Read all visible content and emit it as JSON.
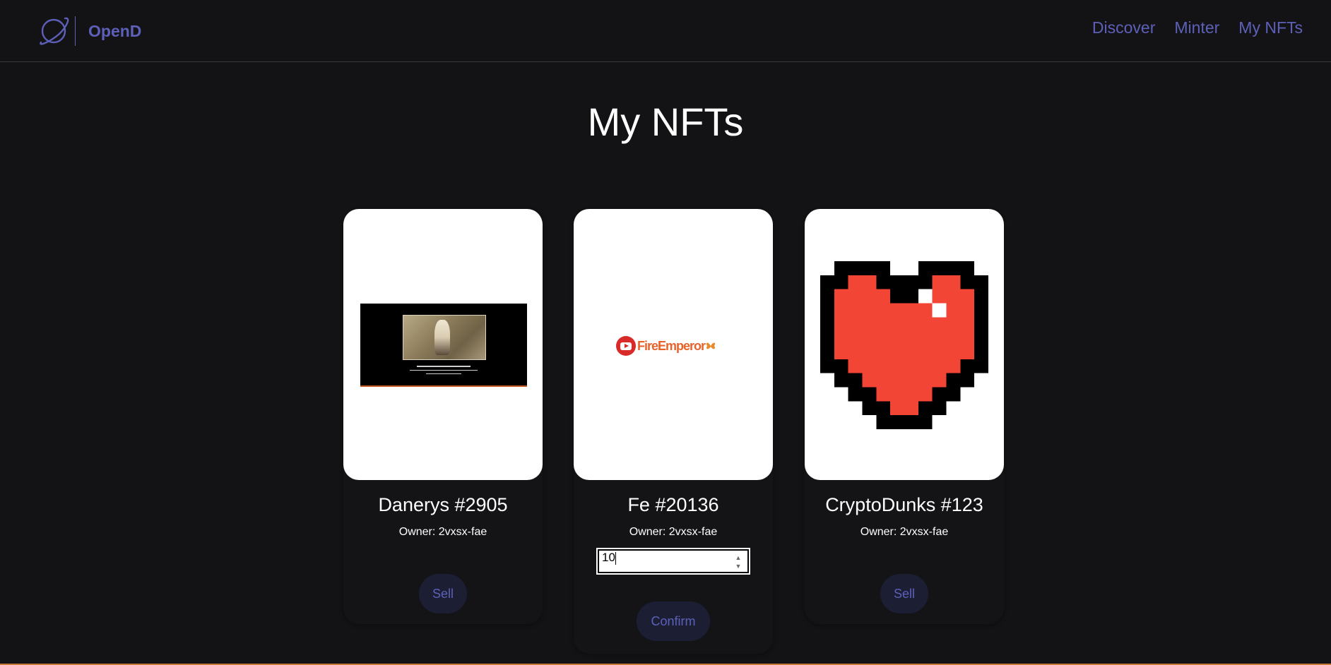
{
  "brand": {
    "name": "OpenD",
    "logo_icon": "planet-icon"
  },
  "nav": {
    "discover": "Discover",
    "minter": "Minter",
    "my_nfts": "My NFTs"
  },
  "page": {
    "title": "My NFTs"
  },
  "cards": [
    {
      "name": "Danerys #2905",
      "owner": "Owner: 2vxsx-fae",
      "action": "Sell",
      "image": "daenerys-thumbnail"
    },
    {
      "name": "Fe #20136",
      "owner": "Owner: 2vxsx-fae",
      "price_value": "10",
      "action": "Confirm",
      "image": "fireemperor-logo",
      "logo_text": "FireEmperor"
    },
    {
      "name": "CryptoDunks #123",
      "owner": "Owner: 2vxsx-fae",
      "action": "Sell",
      "image": "pixel-heart"
    }
  ],
  "colors": {
    "accent": "#5d60b8",
    "background": "#131316",
    "button_bg": "#1c1f34",
    "heart_red": "#f24535"
  }
}
